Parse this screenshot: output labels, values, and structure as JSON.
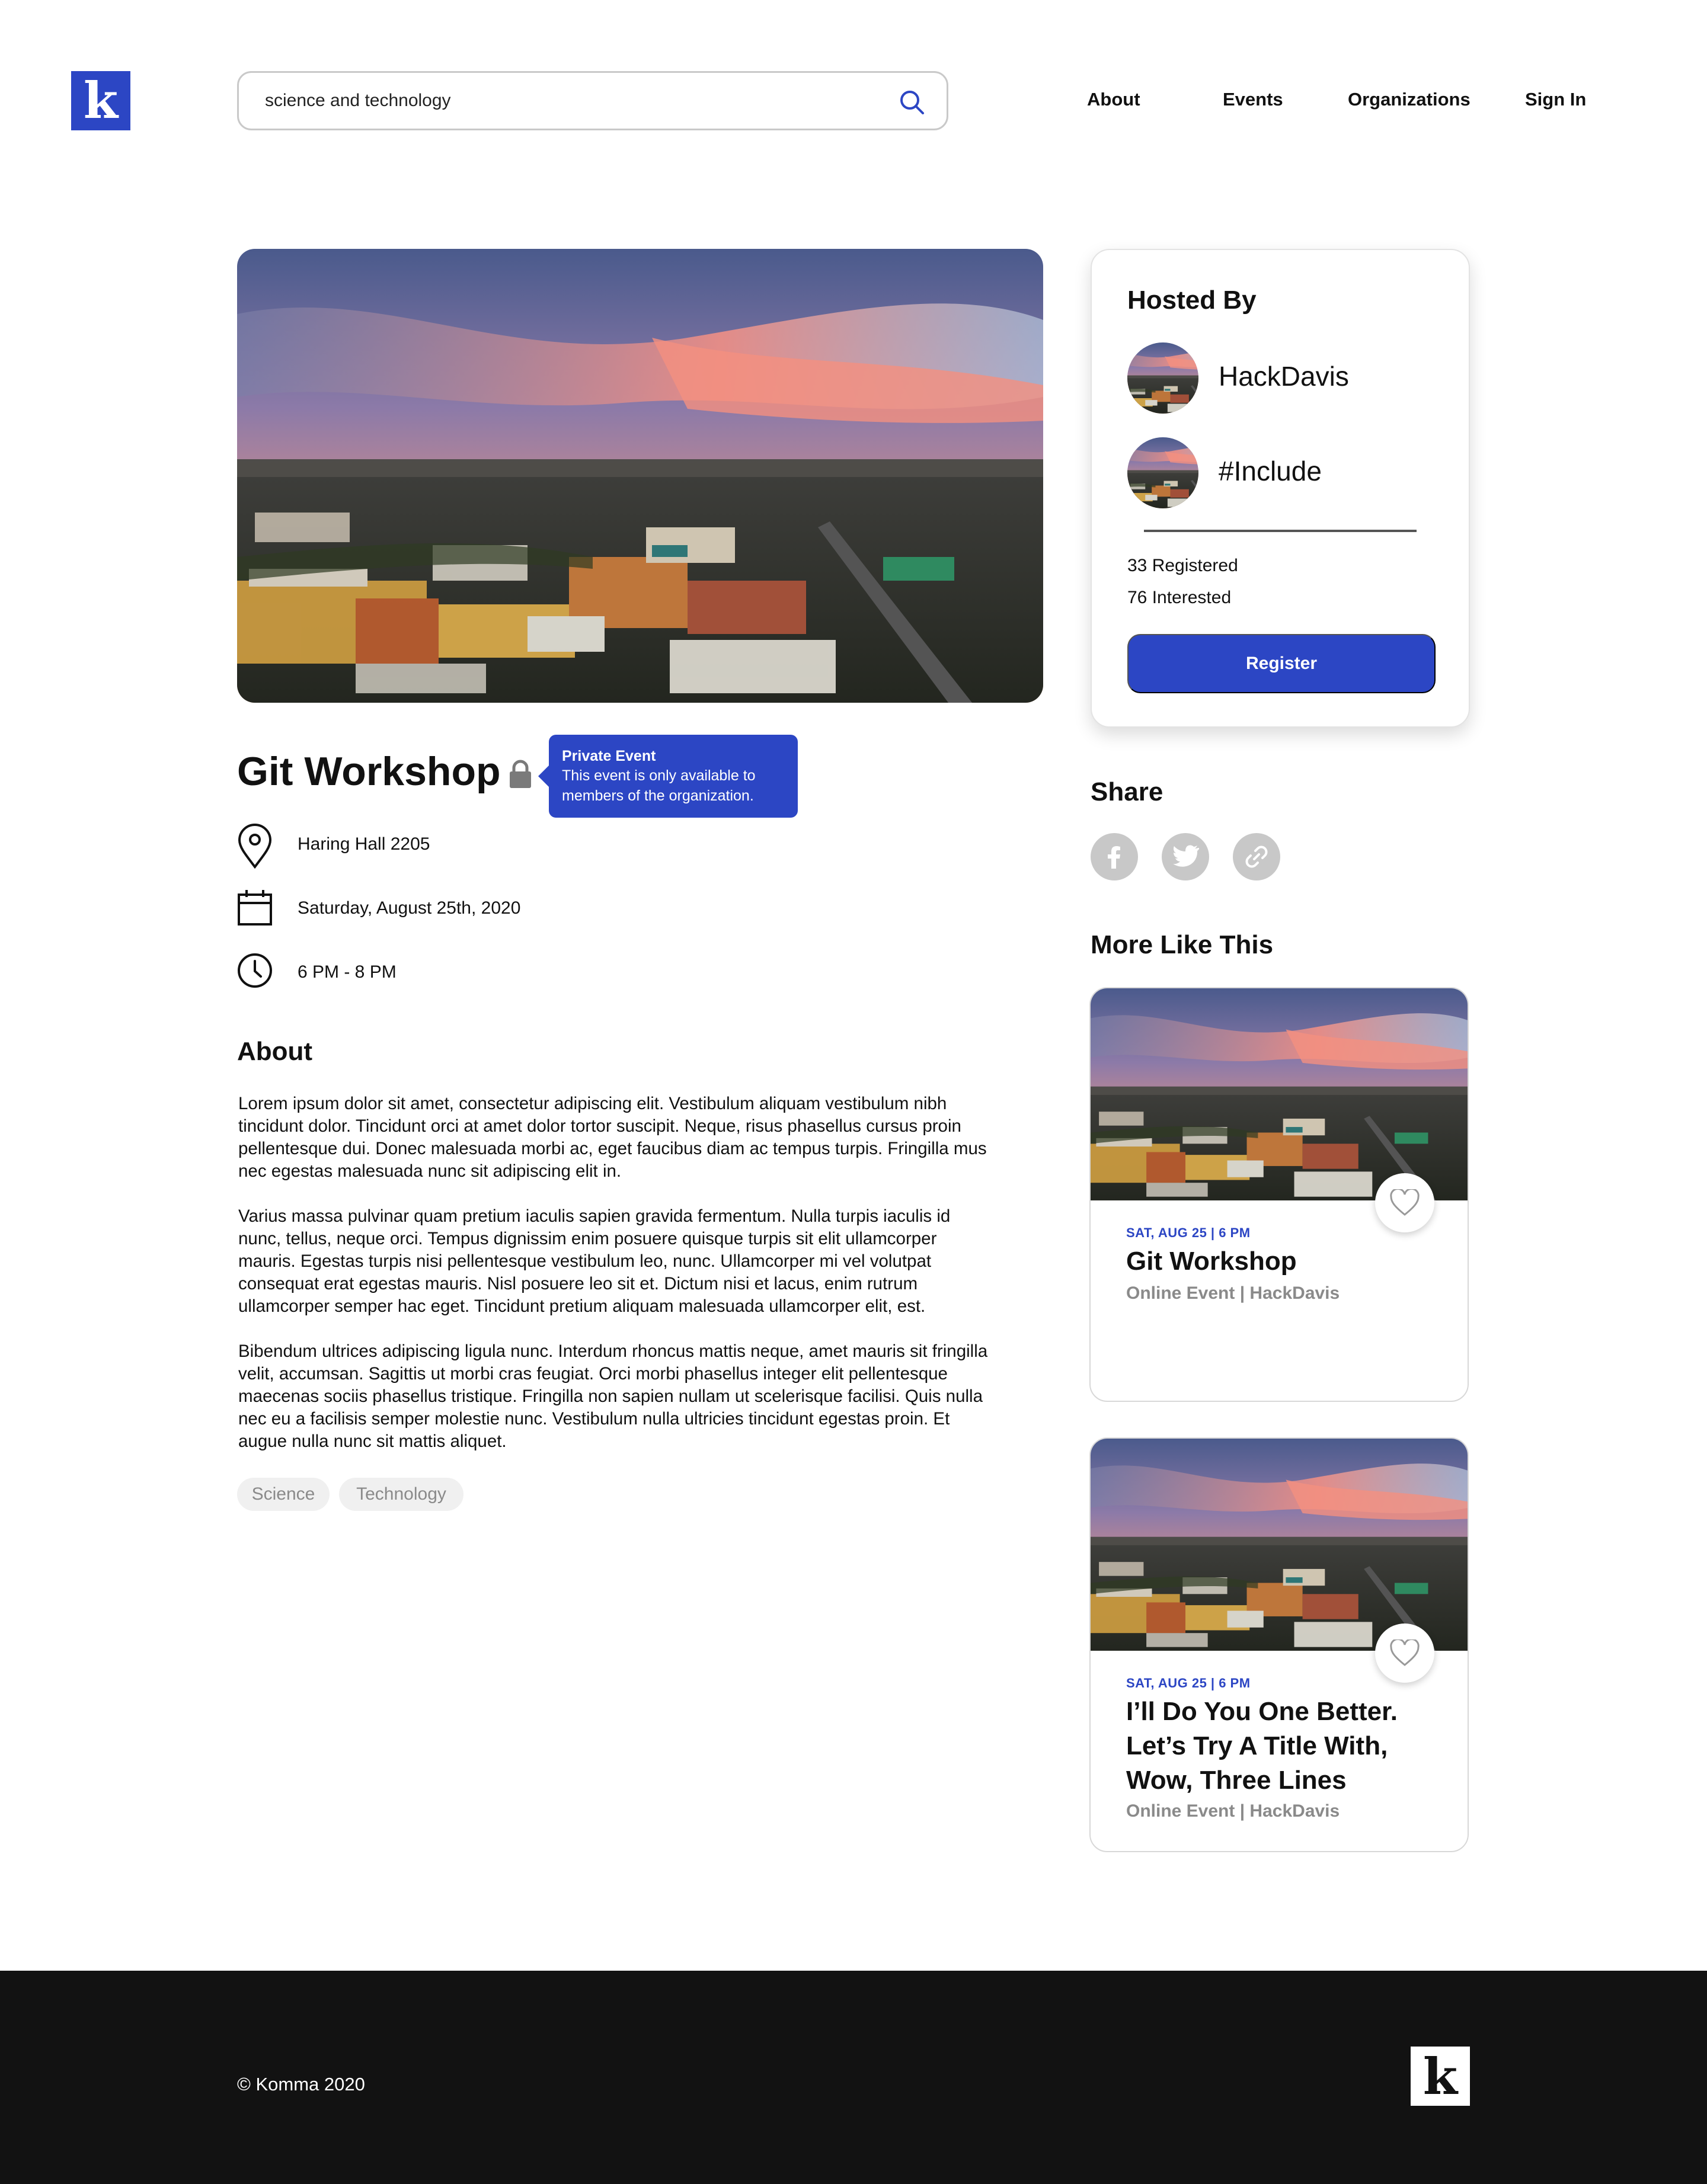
{
  "brand": {
    "logo_letter": "k",
    "accent": "#2c46c4"
  },
  "search": {
    "value": "science and technology"
  },
  "nav": [
    "About",
    "Events",
    "Organizations",
    "Sign In"
  ],
  "event": {
    "title": "Git Workshop",
    "tooltip": {
      "title": "Private Event",
      "line1": "This event is only available to",
      "line2": "members of the organization."
    },
    "location": "Haring Hall 2205",
    "date": "Saturday, August 25th, 2020",
    "time": "6 PM - 8 PM",
    "about_heading": "About",
    "paragraphs": [
      [
        "Lorem ipsum dolor sit amet, consectetur adipiscing elit. Vestibulum aliquam vestibulum nibh",
        "tincidunt dolor. Tincidunt orci at amet dolor tortor suscipit. Neque, risus phasellus cursus proin",
        "pellentesque dui. Donec malesuada morbi ac, eget faucibus diam ac tempus turpis. Fringilla mus",
        "nec egestas malesuada nunc sit adipiscing elit in."
      ],
      [
        "Varius massa pulvinar quam pretium iaculis sapien gravida fermentum. Nulla turpis iaculis id",
        "nunc, tellus, neque orci. Tempus dignissim enim posuere quisque turpis sit elit ullamcorper",
        "mauris. Egestas turpis nisi pellentesque vestibulum leo, nunc. Ullamcorper mi vel volutpat",
        "consequat erat egestas mauris. Nisl posuere leo sit et. Dictum nisi et lacus, enim rutrum",
        "ullamcorper semper hac eget. Tincidunt pretium aliquam malesuada ullamcorper elit, est."
      ],
      [
        "Bibendum ultrices adipiscing ligula nunc. Interdum rhoncus mattis neque, amet mauris sit fringilla",
        "velit, accumsan. Sagittis ut morbi cras feugiat. Orci morbi phasellus integer elit pellentesque",
        "maecenas sociis phasellus tristique. Fringilla non sapien nullam ut scelerisque facilisi. Quis nulla",
        "nec eu a facilisis semper molestie nunc. Vestibulum nulla ultricies tincidunt egestas proin. Et",
        "augue nulla nunc sit mattis aliquet."
      ]
    ],
    "tags": [
      "Science",
      "Technology"
    ]
  },
  "hosted": {
    "heading": "Hosted By",
    "hosts": [
      "HackDavis",
      "#Include"
    ],
    "registered": "33 Registered",
    "interested": "76 Interested",
    "register_label": "Register"
  },
  "share": {
    "heading": "Share",
    "icons": [
      "facebook-icon",
      "twitter-icon",
      "link-icon"
    ]
  },
  "more": {
    "heading": "More Like This",
    "cards": [
      {
        "date": "SAT, AUG 25 | 6 PM",
        "title_lines": [
          "Git Workshop"
        ],
        "sub": "Online Event | HackDavis"
      },
      {
        "date": "SAT, AUG 25 | 6 PM",
        "title_lines": [
          "I’ll Do You One Better.",
          "Let’s Try A Title With,",
          "Wow, Three Lines"
        ],
        "sub": "Online Event | HackDavis"
      }
    ]
  },
  "footer": {
    "copyright": "© Komma 2020",
    "logo_letter": "k"
  }
}
